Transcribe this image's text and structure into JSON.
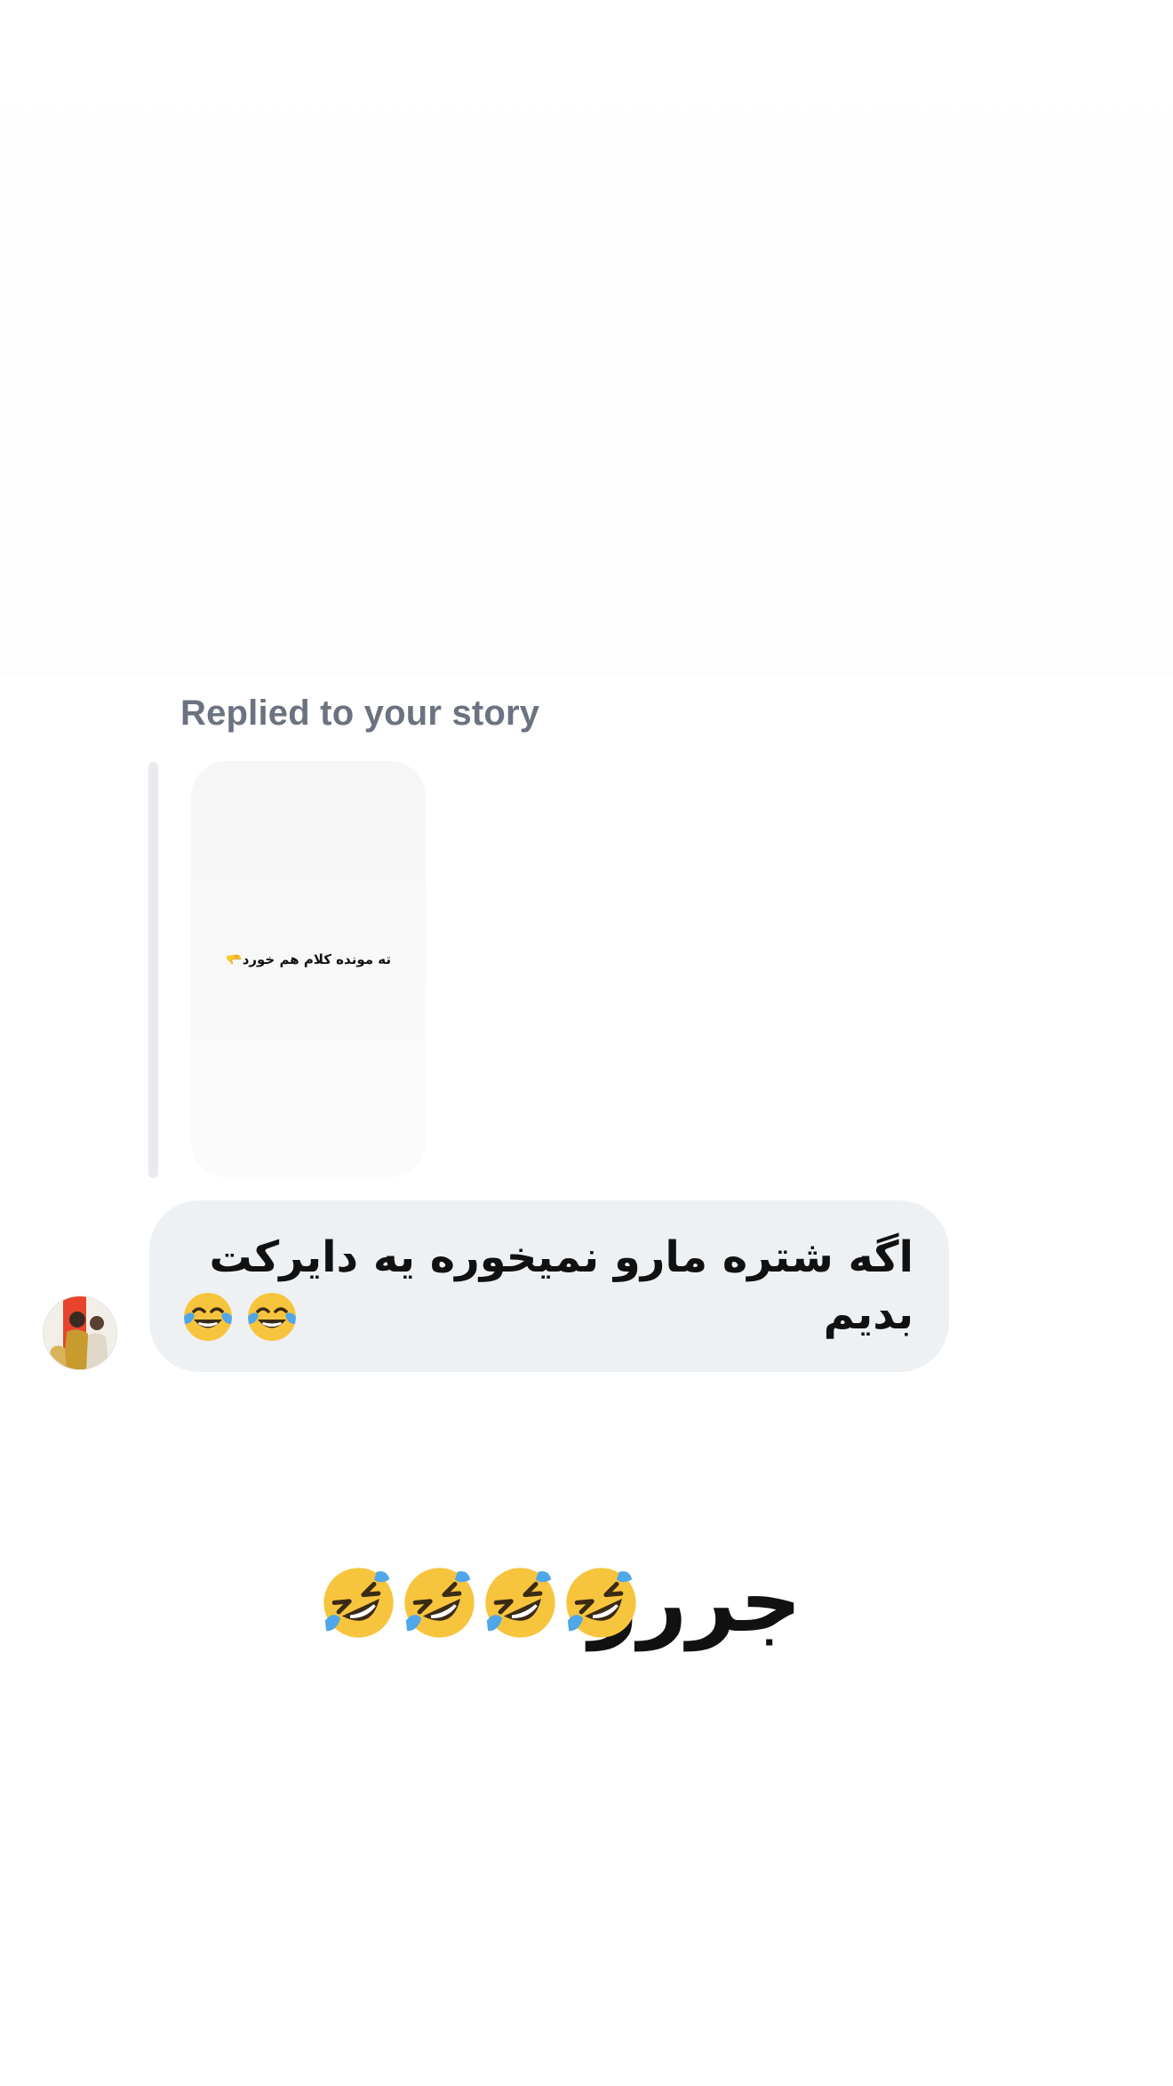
{
  "thread": {
    "reply_label": "Replied to your story",
    "story": {
      "text": "ته مونده کلام هم خورد🫳"
    },
    "incoming_message": {
      "text": "اگه شتره مارو نمیخوره یه دایرکت بدیم",
      "emojis": [
        "face-with-tears-of-joy-icon",
        "face-with-tears-of-joy-icon"
      ]
    },
    "outgoing_message": {
      "text": "جررر",
      "emojis": [
        "rolling-on-the-floor-laughing-icon",
        "rolling-on-the-floor-laughing-icon",
        "rolling-on-the-floor-laughing-icon",
        "rolling-on-the-floor-laughing-icon"
      ]
    }
  },
  "colors": {
    "bubble_bg": "#eef1f4",
    "reply_label": "#6b7280",
    "reply_bar": "#e8eaee",
    "emoji_yellow": "#f7c43d"
  }
}
